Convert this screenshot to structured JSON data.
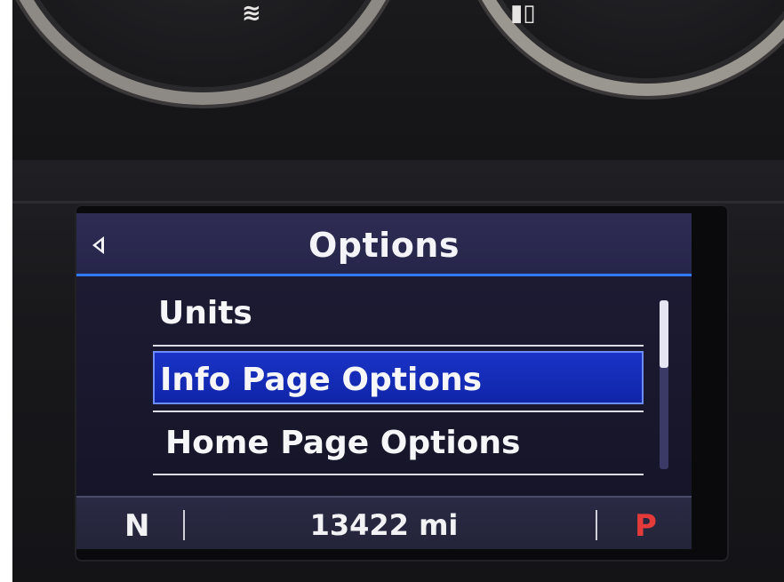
{
  "display": {
    "title": "Options",
    "back_icon": "triangle-left-icon",
    "menu": {
      "items": [
        {
          "label": "Units",
          "selected": false
        },
        {
          "label": "Info Page Options",
          "selected": true
        },
        {
          "label": "Home Page Options",
          "selected": false
        }
      ],
      "scroll_fraction_visible": 0.4
    },
    "status_bar": {
      "gear_left": "N",
      "odometer": "13422 mi",
      "gear_right": "P"
    }
  },
  "colors": {
    "accent": "#2f7bff",
    "selection": "#1a33c6",
    "park_indicator": "#e53a3a"
  }
}
